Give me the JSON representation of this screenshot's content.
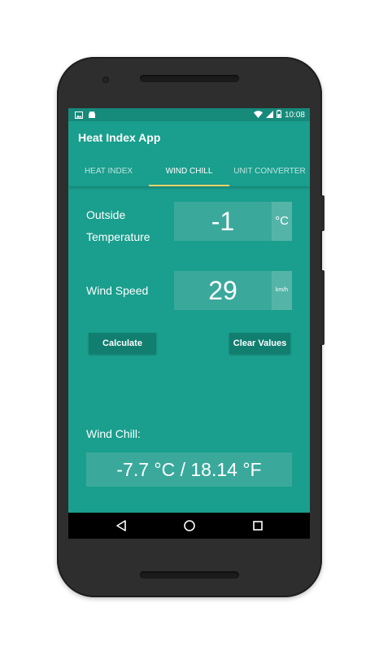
{
  "status_bar": {
    "time": "10:08",
    "icons": [
      "image-icon",
      "android-icon",
      "wifi-icon",
      "signal-icon",
      "battery-icon"
    ]
  },
  "app_bar": {
    "title": "Heat Index App"
  },
  "tabs": [
    {
      "label": "HEAT INDEX",
      "active": false
    },
    {
      "label": "WIND CHILL",
      "active": true
    },
    {
      "label": "UNIT CONVERTER",
      "active": false
    }
  ],
  "form": {
    "temperature_label_line1": "Outside",
    "temperature_label_line2": "Temperature",
    "temperature_value": "-1",
    "temperature_unit": "°C",
    "wind_label": "Wind Speed",
    "wind_value": "29",
    "wind_unit": "km/h",
    "calculate_label": "Calculate",
    "clear_label": "Clear Values"
  },
  "result": {
    "label": "Wind Chill:",
    "value": "-7.7 °C / 18.14 °F"
  },
  "nav": {
    "icons": [
      "back-icon",
      "home-icon",
      "recents-icon"
    ]
  },
  "colors": {
    "primary": "#1a9e8d",
    "status_bar": "#168a7b",
    "field": "#3aa99c",
    "button": "#127e70",
    "tab_indicator": "#f3d26a"
  }
}
